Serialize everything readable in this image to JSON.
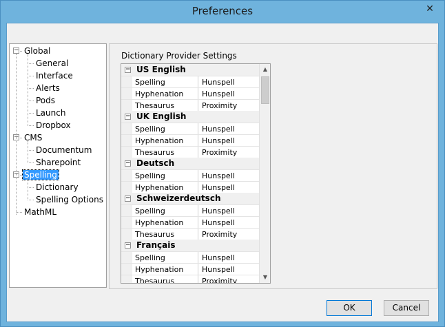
{
  "window": {
    "title": "Preferences"
  },
  "titlebar": {
    "close_glyph": "✕"
  },
  "tree": {
    "items": [
      {
        "label": "Global",
        "level": 0,
        "expanded": true
      },
      {
        "label": "General",
        "level": 1
      },
      {
        "label": "Interface",
        "level": 1
      },
      {
        "label": "Alerts",
        "level": 1
      },
      {
        "label": "Pods",
        "level": 1
      },
      {
        "label": "Launch",
        "level": 1
      },
      {
        "label": "Dropbox",
        "level": 1
      },
      {
        "label": "CMS",
        "level": 0,
        "expanded": true
      },
      {
        "label": "Documentum",
        "level": 1
      },
      {
        "label": "Sharepoint",
        "level": 1
      },
      {
        "label": "Spelling",
        "level": 0,
        "expanded": true,
        "selected": true
      },
      {
        "label": "Dictionary",
        "level": 1
      },
      {
        "label": "Spelling Options",
        "level": 1
      },
      {
        "label": "MathML",
        "level": 0
      }
    ]
  },
  "panel": {
    "label": "Dictionary Provider Settings",
    "categories": [
      {
        "name": "US English",
        "props": [
          {
            "name": "Spelling",
            "value": "Hunspell"
          },
          {
            "name": "Hyphenation",
            "value": "Hunspell"
          },
          {
            "name": "Thesaurus",
            "value": "Proximity"
          }
        ]
      },
      {
        "name": "UK English",
        "props": [
          {
            "name": "Spelling",
            "value": "Hunspell"
          },
          {
            "name": "Hyphenation",
            "value": "Hunspell"
          },
          {
            "name": "Thesaurus",
            "value": "Proximity"
          }
        ]
      },
      {
        "name": "Deutsch",
        "props": [
          {
            "name": "Spelling",
            "value": "Hunspell"
          },
          {
            "name": "Hyphenation",
            "value": "Hunspell"
          }
        ]
      },
      {
        "name": "Schweizerdeutsch",
        "props": [
          {
            "name": "Spelling",
            "value": "Hunspell"
          },
          {
            "name": "Hyphenation",
            "value": "Hunspell"
          },
          {
            "name": "Thesaurus",
            "value": "Proximity"
          }
        ]
      },
      {
        "name": "Français",
        "props": [
          {
            "name": "Spelling",
            "value": "Hunspell"
          },
          {
            "name": "Hyphenation",
            "value": "Hunspell"
          },
          {
            "name": "Thesaurus",
            "value": "Proximity"
          }
        ]
      }
    ]
  },
  "buttons": {
    "ok": "OK",
    "cancel": "Cancel"
  },
  "scrollbar": {
    "up_glyph": "▲",
    "down_glyph": "▼"
  },
  "expander_glyph": "−"
}
